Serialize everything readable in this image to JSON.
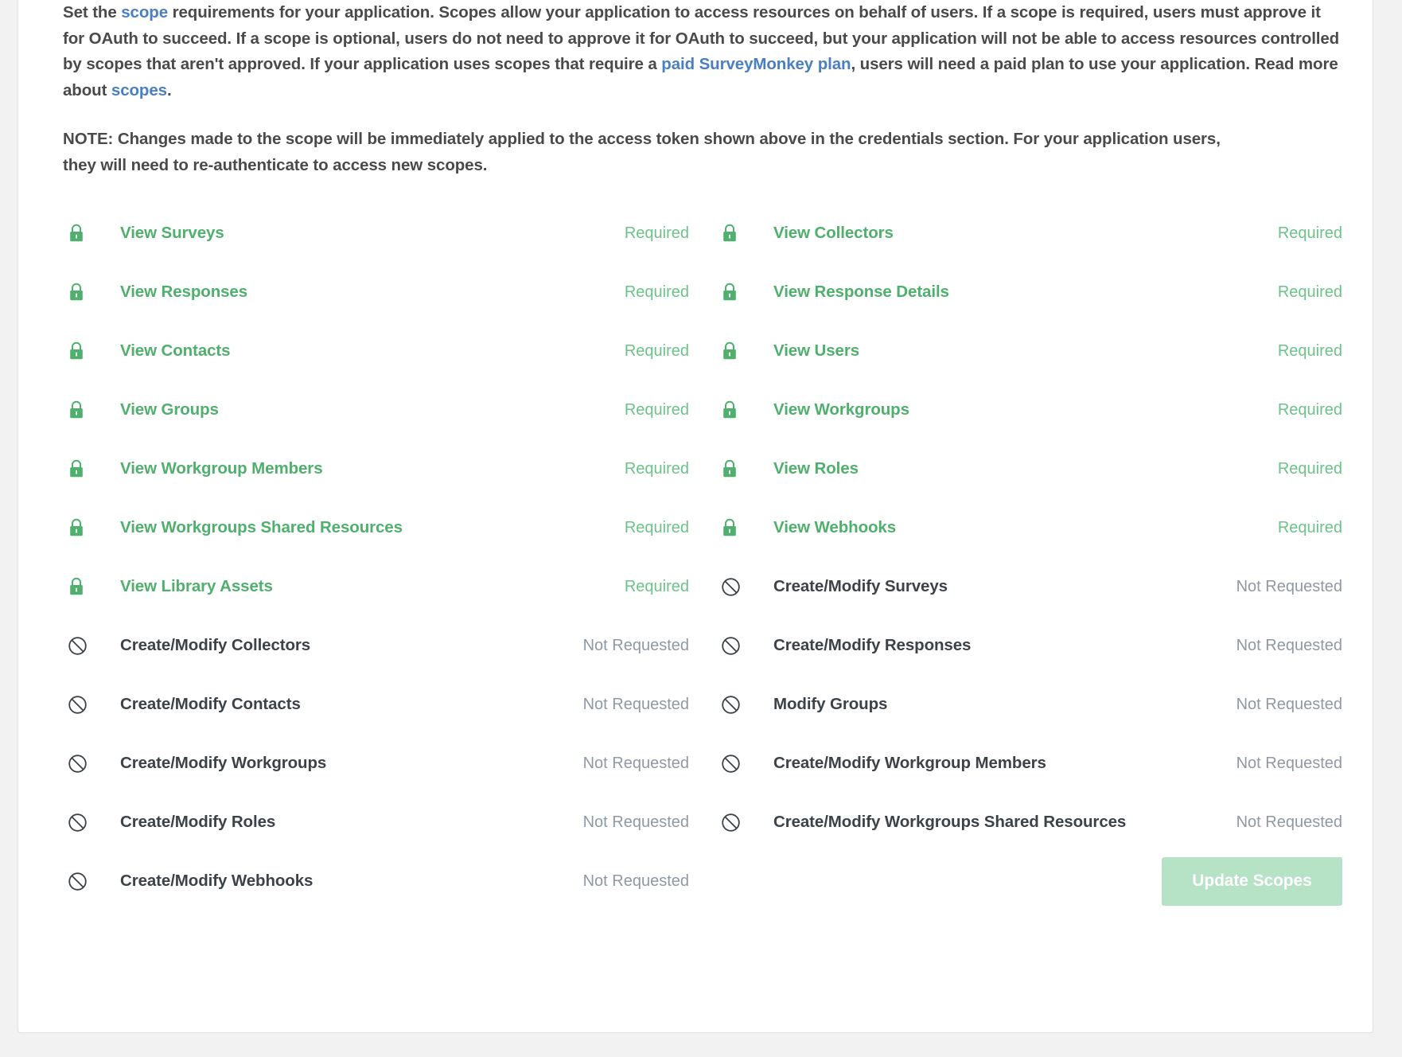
{
  "intro": {
    "part1": "Set the ",
    "link_scope": "scope",
    "part2": " requirements for your application. Scopes allow your application to access resources on behalf of users. If a scope is required, users must approve it for OAuth to succeed. If a scope is optional, users do not need to approve it for OAuth to succeed, but your application will not be able to access resources controlled by scopes that aren't approved. If your application uses scopes that require a ",
    "link_plan": "paid SurveyMonkey plan",
    "part3": ", users will need a paid plan to use your application. Read more about ",
    "link_scopes": "scopes",
    "part4": "."
  },
  "note": {
    "text": "NOTE: Changes made to the scope will be immediately applied to the access token shown above in the credentials section. For your application users, they will need to re-authenticate to access new scopes."
  },
  "status_labels": {
    "required": "Required",
    "not_requested": "Not Requested"
  },
  "icons": {
    "lock": "lock-icon",
    "prohibited": "prohibited-icon"
  },
  "colors": {
    "green_label": "#4fb06d",
    "green_status": "#6cc289",
    "dark_label": "#3b4349",
    "gray_status": "#8d99a3",
    "link_blue": "#4a7fc1",
    "button_bg": "#b6e2c6",
    "card_bg": "#ffffff",
    "page_bg": "#f2f2f2"
  },
  "scopes": {
    "left_column": [
      {
        "label": "View Surveys",
        "status": "Required",
        "state": "required",
        "icon": "lock-icon"
      },
      {
        "label": "View Responses",
        "status": "Required",
        "state": "required",
        "icon": "lock-icon"
      },
      {
        "label": "View Contacts",
        "status": "Required",
        "state": "required",
        "icon": "lock-icon"
      },
      {
        "label": "View Groups",
        "status": "Required",
        "state": "required",
        "icon": "lock-icon"
      },
      {
        "label": "View Workgroup Members",
        "status": "Required",
        "state": "required",
        "icon": "lock-icon"
      },
      {
        "label": "View Workgroups Shared Resources",
        "status": "Required",
        "state": "required",
        "icon": "lock-icon"
      },
      {
        "label": "View Library Assets",
        "status": "Required",
        "state": "required",
        "icon": "lock-icon"
      },
      {
        "label": "Create/Modify Collectors",
        "status": "Not Requested",
        "state": "notrequested",
        "icon": "prohibited-icon"
      },
      {
        "label": "Create/Modify Contacts",
        "status": "Not Requested",
        "state": "notrequested",
        "icon": "prohibited-icon"
      },
      {
        "label": "Create/Modify Workgroups",
        "status": "Not Requested",
        "state": "notrequested",
        "icon": "prohibited-icon"
      },
      {
        "label": "Create/Modify Roles",
        "status": "Not Requested",
        "state": "notrequested",
        "icon": "prohibited-icon"
      },
      {
        "label": "Create/Modify Webhooks",
        "status": "Not Requested",
        "state": "notrequested",
        "icon": "prohibited-icon"
      }
    ],
    "right_column": [
      {
        "label": "View Collectors",
        "status": "Required",
        "state": "required",
        "icon": "lock-icon"
      },
      {
        "label": "View Response Details",
        "status": "Required",
        "state": "required",
        "icon": "lock-icon"
      },
      {
        "label": "View Users",
        "status": "Required",
        "state": "required",
        "icon": "lock-icon"
      },
      {
        "label": "View Workgroups",
        "status": "Required",
        "state": "required",
        "icon": "lock-icon"
      },
      {
        "label": "View Roles",
        "status": "Required",
        "state": "required",
        "icon": "lock-icon"
      },
      {
        "label": "View Webhooks",
        "status": "Required",
        "state": "required",
        "icon": "lock-icon"
      },
      {
        "label": "Create/Modify Surveys",
        "status": "Not Requested",
        "state": "notrequested",
        "icon": "prohibited-icon"
      },
      {
        "label": "Create/Modify Responses",
        "status": "Not Requested",
        "state": "notrequested",
        "icon": "prohibited-icon"
      },
      {
        "label": "Modify Groups",
        "status": "Not Requested",
        "state": "notrequested",
        "icon": "prohibited-icon"
      },
      {
        "label": "Create/Modify Workgroup Members",
        "status": "Not Requested",
        "state": "notrequested",
        "icon": "prohibited-icon"
      },
      {
        "label": "Create/Modify Workgroups Shared Resources",
        "status": "Not Requested",
        "state": "notrequested",
        "icon": "prohibited-icon"
      }
    ]
  },
  "update_button": {
    "label": "Update Scopes"
  }
}
